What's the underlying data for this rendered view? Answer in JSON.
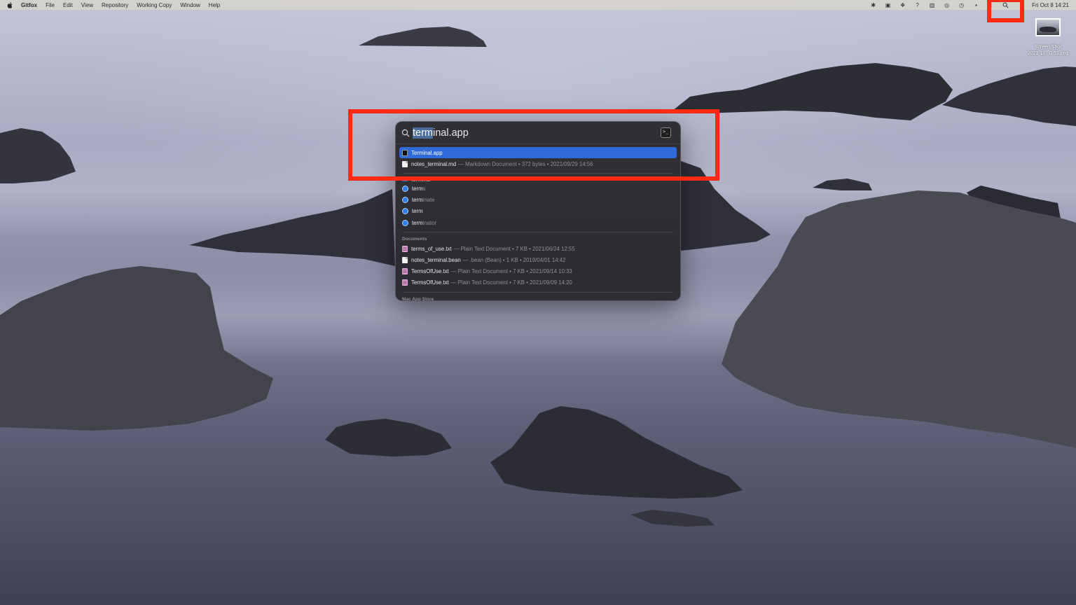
{
  "menubar": {
    "app_name": "Gitfox",
    "menus": [
      "File",
      "Edit",
      "View",
      "Repository",
      "Working Copy",
      "Window",
      "Help"
    ],
    "clock": "Fri Oct 8  14:21"
  },
  "desktop_file": {
    "name_line1": "Screen Shot",
    "name_line2": "2021-10...0.51.png"
  },
  "spotlight": {
    "query_selected": "term",
    "query_rest": "inal.app",
    "results": [
      {
        "name": "Terminal.app",
        "meta": "",
        "icon": "terminal-icon",
        "selected": true
      },
      {
        "name": "notes_terminal.md",
        "meta": "— Markdown Document • 372 bytes • 2021/09/29 14:56",
        "icon": "document-icon",
        "selected": false
      }
    ],
    "cut_row": "terminal",
    "suggestions": [
      {
        "bold": "term",
        "dim": "s"
      },
      {
        "bold": "term",
        "dim": "inate"
      },
      {
        "bold": "term",
        "dim": ""
      },
      {
        "bold": "term",
        "dim": "inator"
      }
    ],
    "documents_header": "Documents",
    "documents": [
      {
        "name": "terms_of_use.txt",
        "meta": "— Plain Text Document • 7 KB • 2021/06/24 12:55"
      },
      {
        "name": "notes_terminal.bean",
        "meta": "— .bean (Bean) • 1 KB • 2019/04/01 14:42"
      },
      {
        "name": "TermsOfUse.txt",
        "meta": "— Plain Text Document • 7 KB • 2021/09/14 10:33"
      },
      {
        "name": "TermsOfUse.txt",
        "meta": "— Plain Text Document • 7 KB • 2021/09/09 14:20"
      }
    ],
    "appstore_header": "Mac App Store"
  },
  "colors": {
    "highlight_red": "#ff2a14",
    "selection_blue": "#2f6ad8"
  }
}
